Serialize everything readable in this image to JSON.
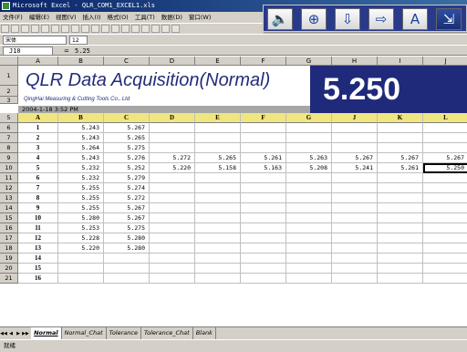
{
  "window": {
    "title": "Microsoft Excel - QLR_COM1_EXCEL1.xls"
  },
  "menu": [
    "文件(F)",
    "编辑(E)",
    "视图(V)",
    "插入(I)",
    "格式(O)",
    "工具(T)",
    "数据(D)",
    "窗口(W)"
  ],
  "toolbar": {
    "font": "宋体",
    "size": "12",
    "zoom": "100%"
  },
  "formula_bar": {
    "cell_ref": "J10",
    "fx": "=",
    "value": "5.25"
  },
  "float_toolbar": [
    {
      "icon": "speaker-icon",
      "glyph": "🔈"
    },
    {
      "icon": "crosshair-icon",
      "glyph": "⊕"
    },
    {
      "icon": "arrow-down-icon",
      "glyph": "⇩"
    },
    {
      "icon": "arrow-right-icon",
      "glyph": "⇨"
    },
    {
      "icon": "font-size-icon",
      "glyph": "A"
    },
    {
      "icon": "exit-icon",
      "glyph": "⇲"
    }
  ],
  "banner": {
    "title": "QLR Data Acquisition(Normal)",
    "subtitle": "QingHai Measuring & Cutting Tools Co., Ltd",
    "datetime": "2004-1-18 3:52 PM",
    "current_value": "5.250"
  },
  "columns": [
    "A",
    "B",
    "C",
    "D",
    "E",
    "F",
    "G",
    "H",
    "I",
    "J"
  ],
  "data_headers": [
    "A",
    "B",
    "C",
    "D",
    "E",
    "F",
    "G",
    "J",
    "K",
    "L"
  ],
  "row_numbers": [
    "1",
    "2",
    "3",
    "5",
    "6",
    "7",
    "8",
    "9",
    "10",
    "11",
    "12",
    "13",
    "14",
    "15",
    "16",
    "17",
    "18",
    "19",
    "20",
    "21"
  ],
  "rows": [
    {
      "n": "1",
      "a": "5.243",
      "b": "5.267",
      "rest": [
        "",
        "",
        "",
        "",
        "",
        "",
        ""
      ]
    },
    {
      "n": "2",
      "a": "5.243",
      "b": "5.265",
      "rest": [
        "",
        "",
        "",
        "",
        "",
        "",
        ""
      ]
    },
    {
      "n": "3",
      "a": "5.264",
      "b": "5.275",
      "rest": [
        "",
        "",
        "",
        "",
        "",
        "",
        ""
      ]
    },
    {
      "n": "4",
      "a": "5.243",
      "b": "5.276",
      "rest": [
        "5.272",
        "5.265",
        "5.261",
        "5.263",
        "5.267",
        "5.267",
        "5.267"
      ]
    },
    {
      "n": "5",
      "a": "5.232",
      "b": "5.252",
      "rest": [
        "5.220",
        "5.158",
        "5.163",
        "5.208",
        "5.241",
        "5.261",
        "5.250"
      ]
    },
    {
      "n": "6",
      "a": "5.232",
      "b": "5.279",
      "rest": [
        "",
        "",
        "",
        "",
        "",
        "",
        ""
      ]
    },
    {
      "n": "7",
      "a": "5.255",
      "b": "5.274",
      "rest": [
        "",
        "",
        "",
        "",
        "",
        "",
        ""
      ]
    },
    {
      "n": "8",
      "a": "5.255",
      "b": "5.272",
      "rest": [
        "",
        "",
        "",
        "",
        "",
        "",
        ""
      ]
    },
    {
      "n": "9",
      "a": "5.255",
      "b": "5.267",
      "rest": [
        "",
        "",
        "",
        "",
        "",
        "",
        ""
      ]
    },
    {
      "n": "10",
      "a": "5.280",
      "b": "5.267",
      "rest": [
        "",
        "",
        "",
        "",
        "",
        "",
        ""
      ]
    },
    {
      "n": "11",
      "a": "5.253",
      "b": "5.275",
      "rest": [
        "",
        "",
        "",
        "",
        "",
        "",
        ""
      ]
    },
    {
      "n": "12",
      "a": "5.228",
      "b": "5.280",
      "rest": [
        "",
        "",
        "",
        "",
        "",
        "",
        ""
      ]
    },
    {
      "n": "13",
      "a": "5.220",
      "b": "5.280",
      "rest": [
        "",
        "",
        "",
        "",
        "",
        "",
        ""
      ]
    },
    {
      "n": "14",
      "a": "",
      "b": "",
      "rest": [
        "",
        "",
        "",
        "",
        "",
        "",
        ""
      ]
    },
    {
      "n": "15",
      "a": "",
      "b": "",
      "rest": [
        "",
        "",
        "",
        "",
        "",
        "",
        ""
      ]
    },
    {
      "n": "16",
      "a": "",
      "b": "",
      "rest": [
        "",
        "",
        "",
        "",
        "",
        "",
        ""
      ]
    }
  ],
  "sheets": [
    "Normal",
    "Normal_Chat",
    "Tolerance",
    "Tolerance_Chat",
    "Blank"
  ],
  "status": "就绪",
  "colors": {
    "banner_blue": "#1f2a7a",
    "header_yellow": "#f0e680",
    "title_bar": "#0a246a"
  }
}
